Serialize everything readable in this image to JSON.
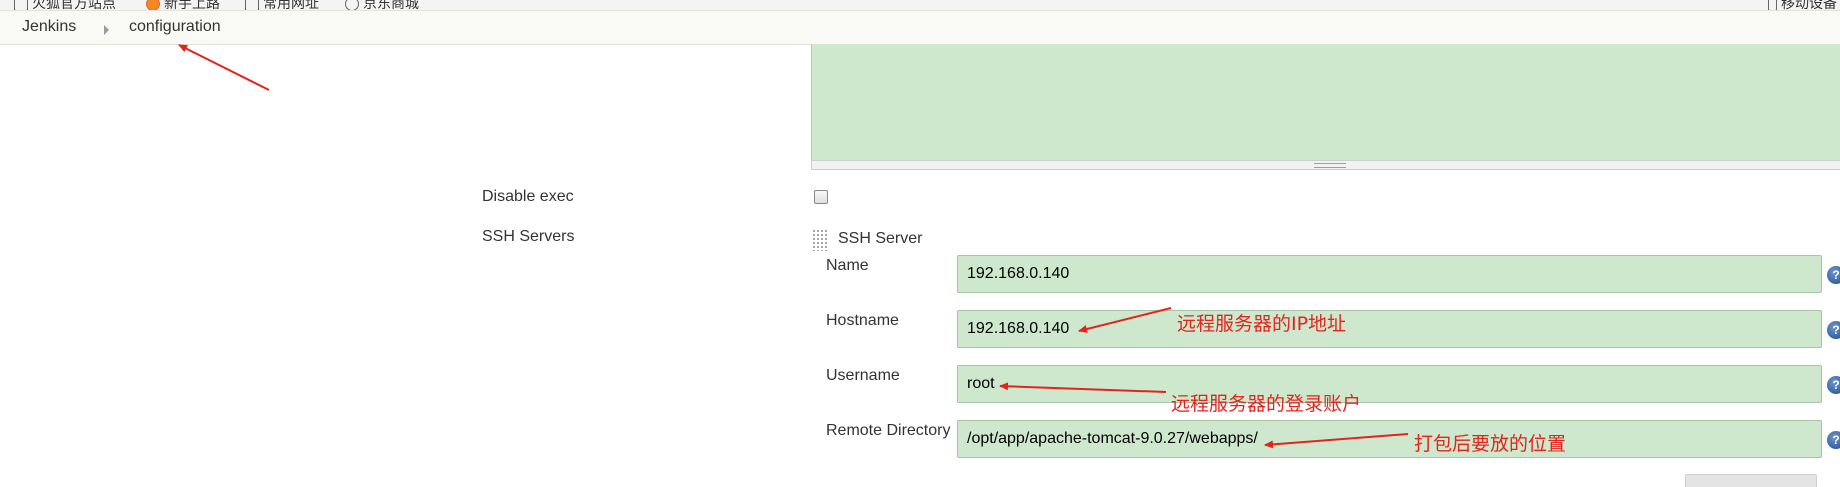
{
  "bookmarks": {
    "items": [
      {
        "label": "火狐官方站点"
      },
      {
        "label": "新手上路"
      },
      {
        "label": "常用网址"
      },
      {
        "label": "京东商城"
      }
    ],
    "right_item": "移动设备"
  },
  "breadcrumb": {
    "root": "Jenkins",
    "current": "configuration"
  },
  "form": {
    "disable_exec_label": "Disable exec",
    "disable_exec_checked": false,
    "ssh_servers_label": "SSH Servers",
    "ssh_server_title": "SSH Server",
    "fields": {
      "name": {
        "label": "Name",
        "value": "192.168.0.140"
      },
      "hostname": {
        "label": "Hostname",
        "value": "192.168.0.140"
      },
      "username": {
        "label": "Username",
        "value": "root"
      },
      "remote_directory": {
        "label": "Remote Directory",
        "value": "/opt/app/apache-tomcat-9.0.27/webapps/"
      }
    },
    "help_icon": "?"
  },
  "annotations": {
    "hostname_note": "远程服务器的IP地址",
    "username_note": "远程服务器的登录账户",
    "remote_dir_note": "打包后要放的位置"
  },
  "colors": {
    "annotation_red": "#e5231d",
    "field_green": "#cde8cd"
  }
}
